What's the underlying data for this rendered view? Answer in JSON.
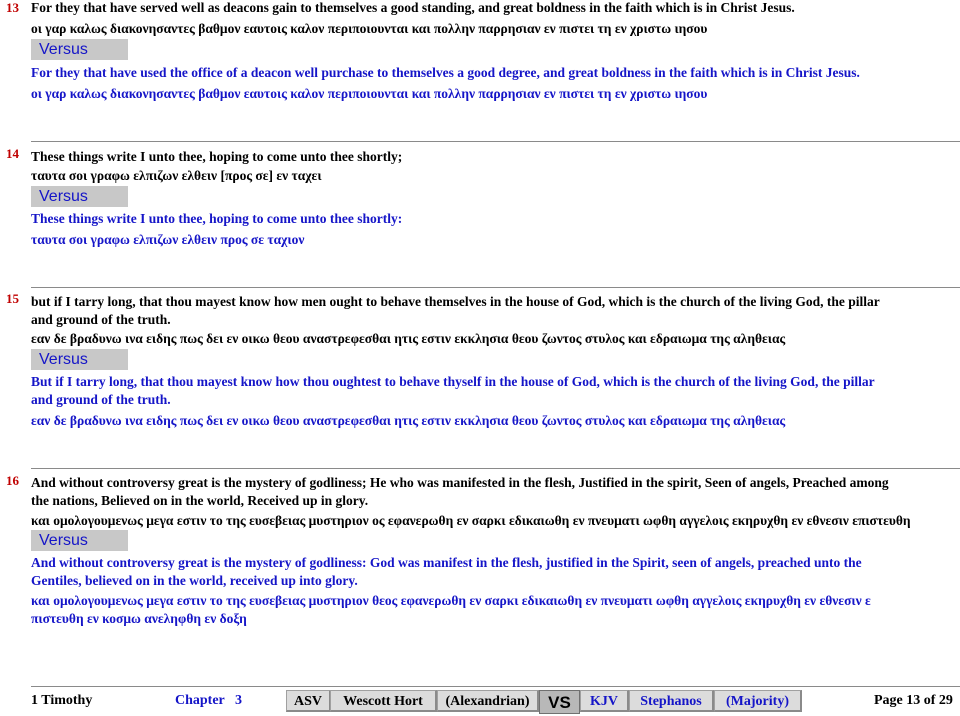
{
  "verses": [
    {
      "number": "13",
      "kjv_text": "For they that have served well as deacons gain to themselves a good standing, and great boldness in the faith which is in Christ Jesus.",
      "kjv_greek": "οι γαρ καλως διακονησαντες βαθμον εαυτοις καλον περιποιουνται και πολλην παρρησιαν εν πιστει τη εν χριστω ιησου",
      "versus_label": "Versus",
      "alt_text": "For they that have used the office of a deacon well purchase to themselves a good degree, and great boldness in the faith which is in Christ Jesus.",
      "alt_greek": "οι γαρ καλως διακονησαντες βαθμον εαυτοις καλον περιποιουνται και πολλην παρρησιαν εν πιστει τη εν χριστω ιησου"
    },
    {
      "number": "14",
      "kjv_text": "These things write I unto thee, hoping to come unto thee shortly;",
      "kjv_greek": "ταυτα σοι γραφω ελπιζων ελθειν [προς σε] εν ταχει",
      "versus_label": "Versus",
      "alt_text": "These things write I unto thee, hoping to come unto thee shortly:",
      "alt_greek": "ταυτα σοι γραφω ελπιζων ελθειν προς σε ταχιον"
    },
    {
      "number": "15",
      "kjv_text_1": "but if I tarry long, that thou mayest know how men ought to behave themselves in the house of God, which is the church of the living God, the pillar",
      "kjv_text_2": "and ground of the truth.",
      "kjv_greek": "εαν δε βραδυνω ινα ειδης πως δει εν οικω θεου αναστρεφεσθαι ητις εστιν εκκλησια θεου ζωντος στυλος και εδραιωμα της αληθειας",
      "versus_label": "Versus",
      "alt_text_1": "But if I tarry long, that thou mayest know how thou oughtest to behave thyself in the house of God, which is the church of the living God, the pillar",
      "alt_text_2": "and ground of the truth.",
      "alt_greek": "εαν δε βραδυνω ινα ειδης πως δει εν οικω θεου αναστρεφεσθαι ητις εστιν εκκλησια θεου ζωντος στυλος και εδραιωμα της αληθειας"
    },
    {
      "number": "16",
      "kjv_text_1": "And without controversy great is the mystery of godliness; He who was manifested in the flesh, Justified in the spirit, Seen of angels, Preached among",
      "kjv_text_2": "the nations, Believed on in the world, Received up in glory.",
      "kjv_greek": "και ομολογουμενως μεγα εστιν το της ευσεβειας μυστηριον ος εφανερωθη εν σαρκι εδικαιωθη εν πνευματι ωφθη αγγελοις εκηρυχθη εν εθνεσιν επιστευθη",
      "versus_label": "Versus",
      "alt_text_1": "And without controversy great is the mystery of godliness: God was manifest in the flesh, justified in the Spirit, seen of angels, preached unto the",
      "alt_text_2": "Gentiles, believed on in the world, received up into glory.",
      "alt_greek_1": "και ομολογουμενως μεγα εστιν το της ευσεβειας μυστηριον θεος εφανερωθη εν σαρκι εδικαιωθη εν πνευματι ωφθη αγγελοις εκηρυχθη εν εθνεσιν ε",
      "alt_greek_2": "πιστευθη εν κοσμω ανεληφθη εν δοξη"
    }
  ],
  "footer": {
    "book": "1 Timothy",
    "chapter_label": "Chapter",
    "chapter_number": "3",
    "left_texts": [
      "ASV",
      "Wescott  Hort",
      "(Alexandrian)"
    ],
    "vs_label": "VS",
    "right_texts": [
      "KJV",
      "Stephanos",
      "(Majority)"
    ],
    "page_label": "Page 13 of 29"
  },
  "colors": {
    "black_text": "#000000",
    "blue_text": "#1515c8",
    "verse_number": "#c00000",
    "versus_bg": "#c8c8c8"
  }
}
